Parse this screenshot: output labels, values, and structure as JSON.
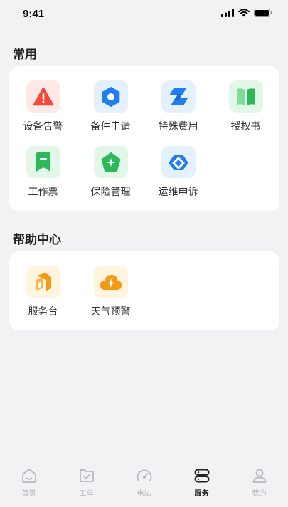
{
  "status_bar": {
    "time": "9:41"
  },
  "sections": [
    {
      "title": "常用",
      "items": [
        {
          "label": "设备告警",
          "icon": "warning-icon",
          "tile_color": "#fde9e6",
          "icon_color": "#f5483b"
        },
        {
          "label": "备件申请",
          "icon": "hexagon-nut-icon",
          "tile_color": "#e4f1fd",
          "icon_color": "#1f7ff0"
        },
        {
          "label": "特殊费用",
          "icon": "stacked-slash-icon",
          "tile_color": "#e4f1fd",
          "icon_color": "#1f7ff0"
        },
        {
          "label": "授权书",
          "icon": "book-icon",
          "tile_color": "#e3f7e8",
          "icon_color": "#2fb75c"
        },
        {
          "label": "工作票",
          "icon": "bookmark-icon",
          "tile_color": "#e3f7e8",
          "icon_color": "#2fb75c"
        },
        {
          "label": "保险管理",
          "icon": "shield-star-icon",
          "tile_color": "#e3f7e8",
          "icon_color": "#2fb75c"
        },
        {
          "label": "运维申诉",
          "icon": "diamond-link-icon",
          "tile_color": "#e4f1fd",
          "icon_color": "#1f7ff0"
        }
      ]
    },
    {
      "title": "帮助中心",
      "items": [
        {
          "label": "服务台",
          "icon": "service-desk-icon",
          "tile_color": "#fff4de",
          "icon_color": "#f49a17"
        },
        {
          "label": "天气预警",
          "icon": "cloud-alert-icon",
          "tile_color": "#fff4de",
          "icon_color": "#f49a17"
        }
      ]
    }
  ],
  "tab_bar": {
    "tabs": [
      {
        "label": "首页",
        "icon": "home-icon",
        "active": false
      },
      {
        "label": "工单",
        "icon": "folder-check-icon",
        "active": false
      },
      {
        "label": "电站",
        "icon": "gauge-icon",
        "active": false
      },
      {
        "label": "服务",
        "icon": "server-icon",
        "active": true
      },
      {
        "label": "我的",
        "icon": "user-icon",
        "active": false
      }
    ]
  },
  "colors": {
    "background": "#f2f2f5",
    "card": "#ffffff",
    "tab_inactive": "#b7b7bc",
    "tab_active": "#222222"
  }
}
